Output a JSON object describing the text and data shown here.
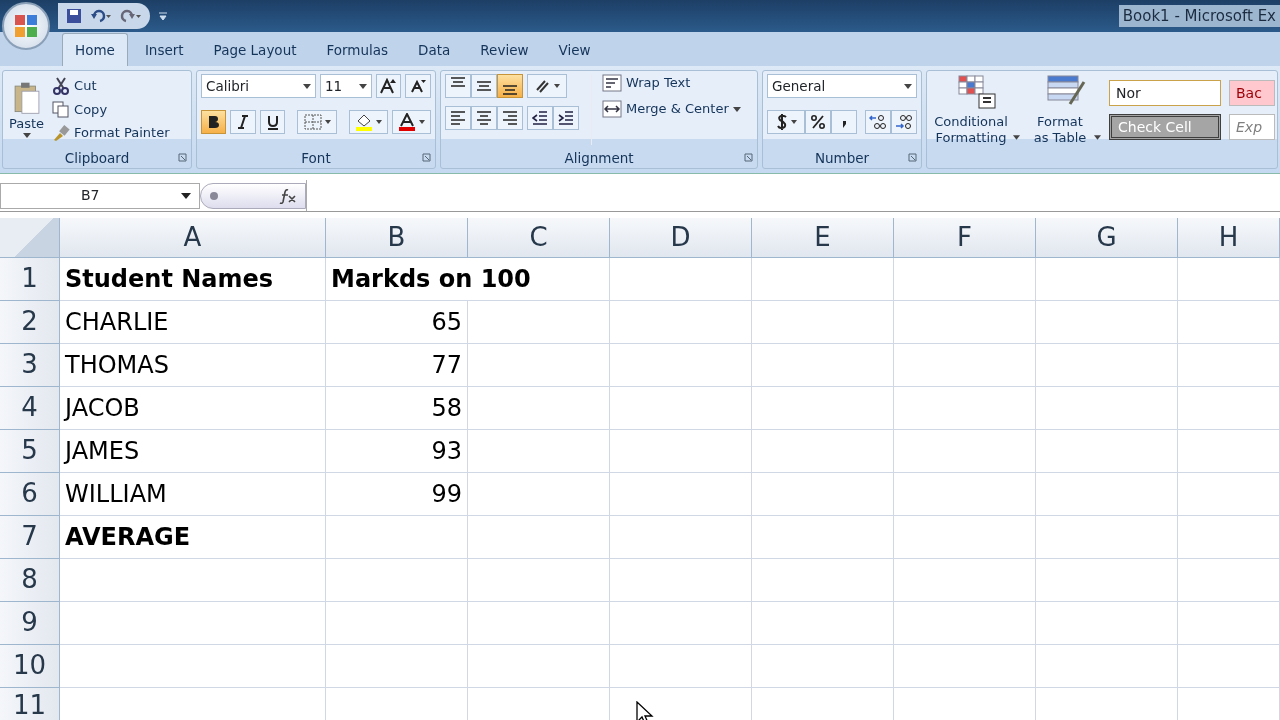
{
  "title_bar": {
    "title": "Book1 - Microsoft Ex"
  },
  "tabs": [
    {
      "label": "Home",
      "selected": true
    },
    {
      "label": "Insert",
      "selected": false
    },
    {
      "label": "Page Layout",
      "selected": false
    },
    {
      "label": "Formulas",
      "selected": false
    },
    {
      "label": "Data",
      "selected": false
    },
    {
      "label": "Review",
      "selected": false
    },
    {
      "label": "View",
      "selected": false
    }
  ],
  "clipboard": {
    "paste": "Paste",
    "cut": "Cut",
    "copy": "Copy",
    "format_painter": "Format Painter",
    "group": "Clipboard"
  },
  "font": {
    "name": "Calibri",
    "size": "11",
    "bold": true,
    "italic": false,
    "underline": false,
    "group": "Font"
  },
  "alignment": {
    "vertical": [
      {
        "selected": false
      },
      {
        "selected": false
      },
      {
        "selected": true
      }
    ],
    "wrap_text": "Wrap Text",
    "merge": "Merge & Center",
    "group": "Alignment"
  },
  "number": {
    "format": "General",
    "group": "Number"
  },
  "styles": {
    "conditional": "Conditional Formatting",
    "format_table": "Format as Table",
    "cells": [
      {
        "label": "Nor",
        "kind": "normal"
      },
      {
        "label": "Bac",
        "kind": "bad"
      },
      {
        "label": "Check Cell",
        "kind": "check"
      },
      {
        "label": "Exp",
        "kind": "explanatory"
      }
    ]
  },
  "formula_bar": {
    "name_box": "B7"
  },
  "sheet": {
    "columns": [
      "A",
      "B",
      "C",
      "D",
      "E",
      "F",
      "G",
      "H"
    ],
    "rows": [
      {
        "header": "1",
        "bold": true,
        "cells": [
          {
            "text": "Student Names",
            "kind": "text"
          },
          {
            "text": "Markds on 100",
            "kind": "text"
          }
        ]
      },
      {
        "header": "2",
        "bold": false,
        "cells": [
          {
            "text": "CHARLIE",
            "kind": "text"
          },
          {
            "text": "65",
            "kind": "number"
          }
        ]
      },
      {
        "header": "3",
        "bold": false,
        "cells": [
          {
            "text": "THOMAS",
            "kind": "text"
          },
          {
            "text": "77",
            "kind": "number"
          }
        ]
      },
      {
        "header": "4",
        "bold": false,
        "cells": [
          {
            "text": "JACOB",
            "kind": "text"
          },
          {
            "text": "58",
            "kind": "number"
          }
        ]
      },
      {
        "header": "5",
        "bold": false,
        "cells": [
          {
            "text": "JAMES",
            "kind": "text"
          },
          {
            "text": "93",
            "kind": "number"
          }
        ]
      },
      {
        "header": "6",
        "bold": false,
        "cells": [
          {
            "text": "WILLIAM",
            "kind": "text"
          },
          {
            "text": "99",
            "kind": "number"
          }
        ]
      },
      {
        "header": "7",
        "bold": true,
        "cells": [
          {
            "text": "AVERAGE",
            "kind": "text"
          }
        ]
      },
      {
        "header": "8"
      },
      {
        "header": "9"
      },
      {
        "header": "10"
      },
      {
        "header": "11"
      }
    ]
  }
}
